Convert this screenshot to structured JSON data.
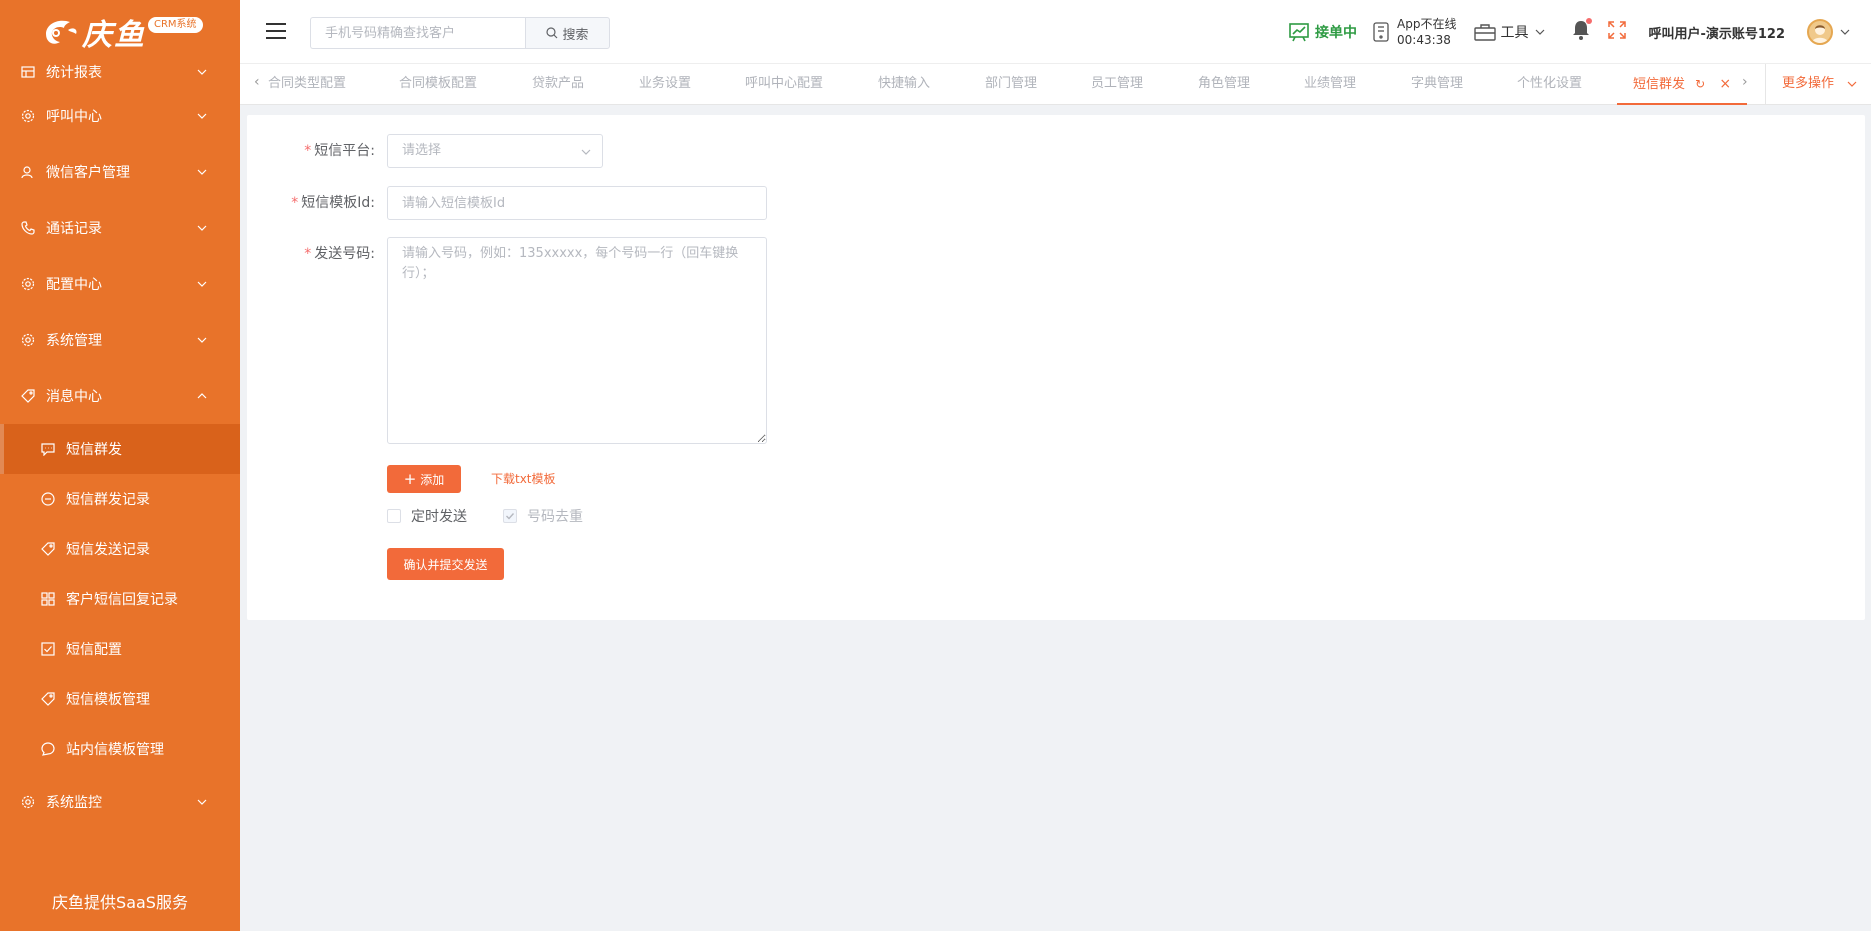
{
  "brand": {
    "logo_text": "庆鱼",
    "badge": "CRM系统",
    "footer": "庆鱼提供SaaS服务"
  },
  "sidebar": {
    "items": [
      {
        "label": "统计报表",
        "icon": "table-icon"
      },
      {
        "label": "呼叫中心",
        "icon": "gear-icon"
      },
      {
        "label": "微信客户管理",
        "icon": "user-icon"
      },
      {
        "label": "通话记录",
        "icon": "phone-icon"
      },
      {
        "label": "配置中心",
        "icon": "gear-icon"
      },
      {
        "label": "系统管理",
        "icon": "gear-icon"
      },
      {
        "label": "消息中心",
        "icon": "tag-icon"
      }
    ],
    "sub_items": [
      {
        "label": "短信群发",
        "icon": "chat-icon",
        "active": true
      },
      {
        "label": "短信群发记录",
        "icon": "minus-circle-icon"
      },
      {
        "label": "短信发送记录",
        "icon": "tag-icon"
      },
      {
        "label": "客户短信回复记录",
        "icon": "grid-icon"
      },
      {
        "label": "短信配置",
        "icon": "checkbox-icon"
      },
      {
        "label": "短信模板管理",
        "icon": "tag-icon"
      },
      {
        "label": "站内信模板管理",
        "icon": "chat-circle-icon"
      }
    ],
    "bottom_item": {
      "label": "系统监控",
      "icon": "gear-icon"
    }
  },
  "header": {
    "search_placeholder": "手机号码精确查找客户",
    "search_button": "搜索",
    "status": "接单中",
    "app_status_line1": "App不在线",
    "app_status_line2": "00:43:38",
    "tools_label": "工具",
    "user_name": "呼叫用户-演示账号122"
  },
  "tabs": {
    "items": [
      "合同类型配置",
      "合同模板配置",
      "贷款产品",
      "业务设置",
      "呼叫中心配置",
      "快捷输入",
      "部门管理",
      "员工管理",
      "角色管理",
      "业绩管理",
      "字典管理",
      "个性化设置"
    ],
    "active": "短信群发",
    "more": "更多操作"
  },
  "form": {
    "platform_label": "短信平台:",
    "platform_placeholder": "请选择",
    "template_label": "短信模板Id:",
    "template_placeholder": "请输入短信模板Id",
    "numbers_label": "发送号码:",
    "numbers_placeholder": "请输入号码，例如：135xxxxx，每个号码一行（回车键换行）；",
    "add_button": "添加",
    "download_link": "下载txt模板",
    "scheduled_label": "定时发送",
    "dedupe_label": "号码去重",
    "submit_button": "确认并提交发送"
  },
  "colors": {
    "sidebar": "#e8732a",
    "accent": "#f26a3a",
    "online": "#2e9b43"
  }
}
